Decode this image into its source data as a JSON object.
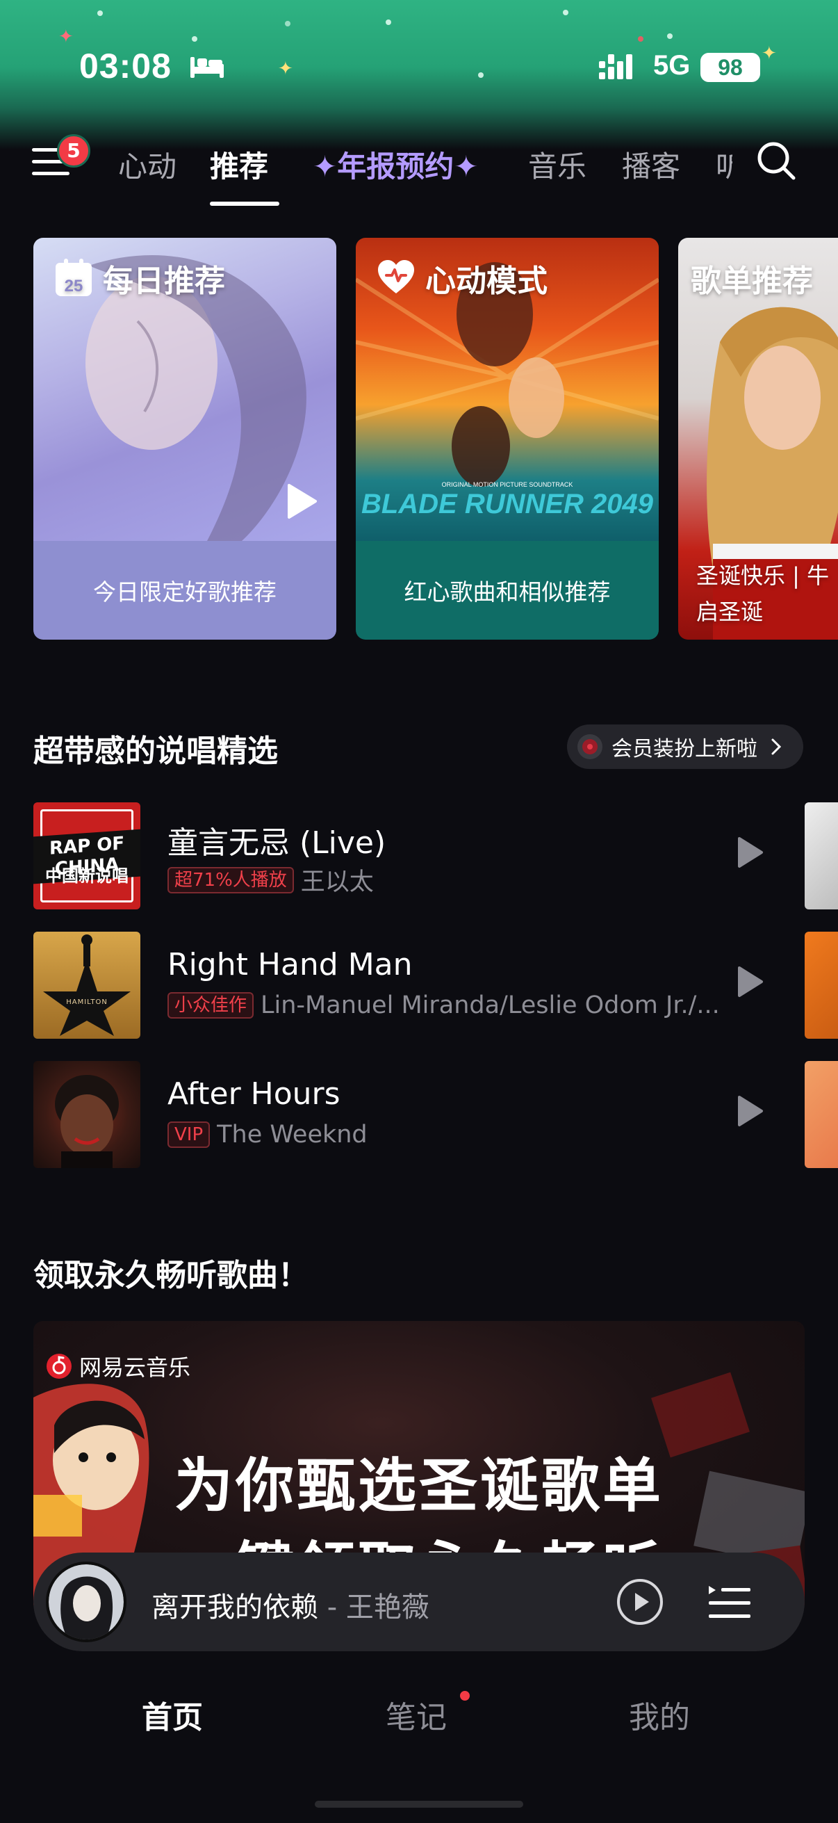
{
  "status_bar": {
    "time": "03:08",
    "network": "5G",
    "battery": "98"
  },
  "top_nav": {
    "menu_badge": "5",
    "tabs": [
      {
        "label": "心动"
      },
      {
        "label": "推荐"
      },
      {
        "label": "✦年报预约✦"
      },
      {
        "label": "音乐"
      },
      {
        "label": "播客"
      },
      {
        "label": "听"
      }
    ],
    "active_tab": "推荐"
  },
  "cards": [
    {
      "title": "每日推荐",
      "calendar_day": "25",
      "caption": "今日限定好歌推荐"
    },
    {
      "title": "心动模式",
      "caption": "红心歌曲和相似推荐",
      "art_text": "BLADE RUNNER 2049",
      "art_small": "ORIGINAL MOTION PICTURE SOUNDTRACK"
    },
    {
      "title": "歌单推荐",
      "caption": "圣诞快乐 | 牛 启圣诞"
    }
  ],
  "section_rap": {
    "title": "超带感的说唱精选",
    "pill_label": "会员装扮上新啦",
    "songs": [
      {
        "name": "童言无忌 (Live)",
        "tag": "超71%人播放",
        "artist": "王以太",
        "cover_text": "中国新说唱"
      },
      {
        "name": "Right Hand Man",
        "tag": "小众佳作",
        "artist": "Lin-Manuel Miranda/Leslie Odom Jr./...",
        "cover_text": "HAMILTON"
      },
      {
        "name": "After Hours",
        "tag": "VIP",
        "artist": "The Weeknd",
        "cover_text": ""
      }
    ]
  },
  "section_banner": {
    "title": "领取永久畅听歌曲！",
    "brand": "网易云音乐",
    "headline": "为你甄选圣诞歌单",
    "headline2": "一键领取永久畅听"
  },
  "mini_player": {
    "track": "离开我的依赖",
    "separator": " - ",
    "artist": "王艳薇"
  },
  "bottom_nav": {
    "items": [
      {
        "label": "首页"
      },
      {
        "label": "笔记"
      },
      {
        "label": "我的"
      }
    ]
  },
  "colors": {
    "accent_red": "#f23b45",
    "status_green": "#2fb383",
    "card2_footer": "#0f6d66",
    "card1_footer": "#8e8fd0"
  }
}
